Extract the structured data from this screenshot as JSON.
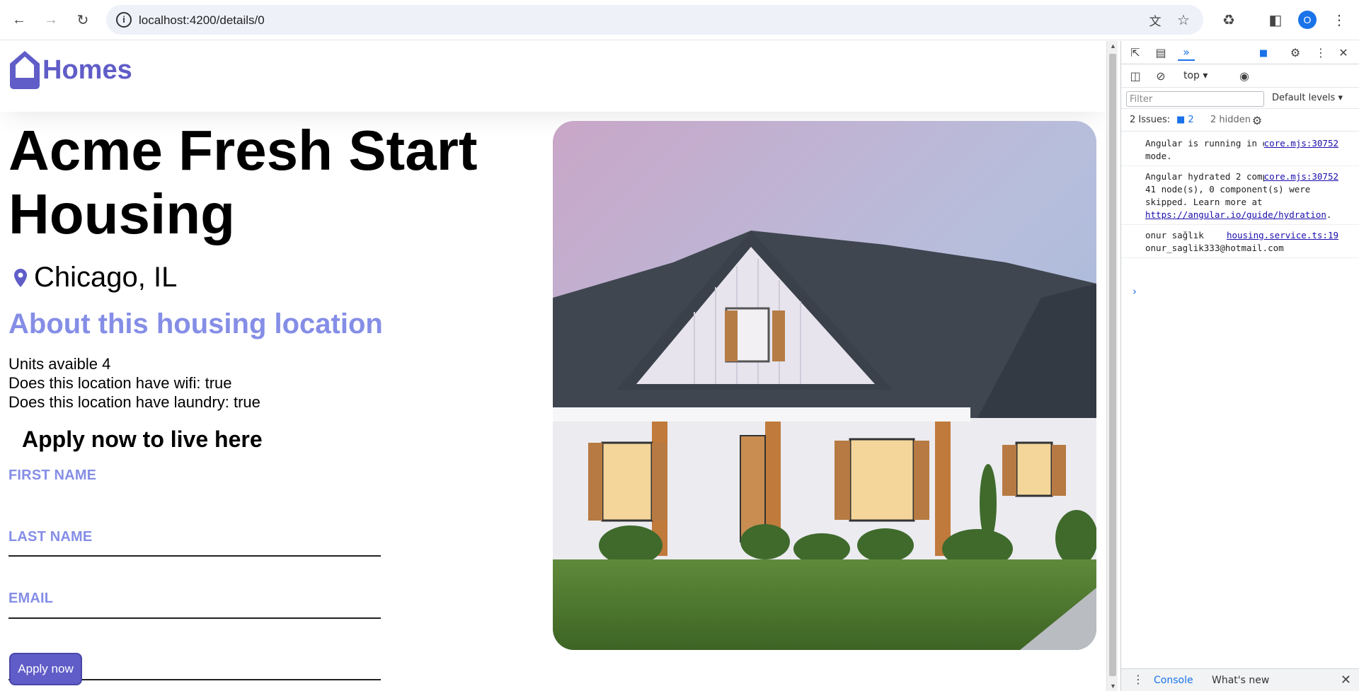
{
  "browser": {
    "url": "localhost:4200/details/0",
    "profile_initial": "O"
  },
  "app": {
    "brand": "Homes"
  },
  "details": {
    "title": "Acme Fresh Start Housing",
    "location": "Chicago, IL",
    "about_heading": "About this housing location",
    "features": [
      "Units avaible 4",
      "Does this location have wifi: true",
      "Does this location have laundry: true"
    ],
    "apply_heading": "Apply now to live here",
    "form": {
      "first_name_label": "FIRST NAME",
      "last_name_label": "LAST NAME",
      "email_label": "EMAIL",
      "first_name_value": "",
      "last_name_value": "",
      "email_value": "",
      "submit_label": "Apply now"
    }
  },
  "devtools": {
    "context": "top",
    "filter_placeholder": "Filter",
    "levels": "Default levels",
    "issues_label": "2 Issues:",
    "issues_count": "2",
    "hidden_label": "2 hidden",
    "messages": [
      {
        "text": "Angular is running in development mode.",
        "source": "core.mjs:30752"
      },
      {
        "text": "Angular hydrated 2 component(s) and 41 node(s), 0 component(s) were skipped. Learn more at",
        "link": "https://angular.io/guide/hydration",
        "suffix": ".",
        "source": "core.mjs:30752"
      },
      {
        "text": "onur sağlık onur_saglik333@hotmail.com",
        "source": "housing.service.ts:19"
      }
    ],
    "drawer_tabs": [
      "Console",
      "What's new"
    ]
  },
  "colors": {
    "brand": "#605DC8",
    "accent_text": "#858EE6"
  }
}
